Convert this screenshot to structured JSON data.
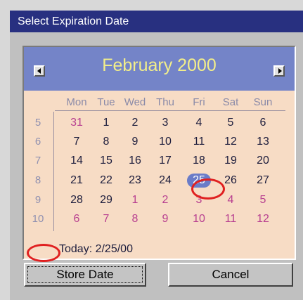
{
  "window": {
    "title": "Select Expiration Date"
  },
  "calendar": {
    "month_label": "February 2000",
    "prev_label": "previous month",
    "next_label": "next month",
    "weekdays": [
      "Mon",
      "Tue",
      "Wed",
      "Thu",
      "Fri",
      "Sat",
      "Sun"
    ],
    "weeks": [
      {
        "num": "5",
        "days": [
          {
            "d": "31",
            "other": true
          },
          {
            "d": "1"
          },
          {
            "d": "2"
          },
          {
            "d": "3"
          },
          {
            "d": "4"
          },
          {
            "d": "5"
          },
          {
            "d": "6"
          }
        ]
      },
      {
        "num": "6",
        "days": [
          {
            "d": "7"
          },
          {
            "d": "8"
          },
          {
            "d": "9"
          },
          {
            "d": "10"
          },
          {
            "d": "11"
          },
          {
            "d": "12"
          },
          {
            "d": "13"
          }
        ]
      },
      {
        "num": "7",
        "days": [
          {
            "d": "14"
          },
          {
            "d": "15"
          },
          {
            "d": "16"
          },
          {
            "d": "17"
          },
          {
            "d": "18"
          },
          {
            "d": "19"
          },
          {
            "d": "20"
          }
        ]
      },
      {
        "num": "8",
        "days": [
          {
            "d": "21"
          },
          {
            "d": "22"
          },
          {
            "d": "23"
          },
          {
            "d": "24"
          },
          {
            "d": "25",
            "selected": true
          },
          {
            "d": "26"
          },
          {
            "d": "27"
          }
        ]
      },
      {
        "num": "9",
        "days": [
          {
            "d": "28"
          },
          {
            "d": "29"
          },
          {
            "d": "1",
            "other": true
          },
          {
            "d": "2",
            "other": true
          },
          {
            "d": "3",
            "other": true
          },
          {
            "d": "4",
            "other": true
          },
          {
            "d": "5",
            "other": true
          }
        ]
      },
      {
        "num": "10",
        "days": [
          {
            "d": "6",
            "other": true
          },
          {
            "d": "7",
            "other": true
          },
          {
            "d": "8",
            "other": true
          },
          {
            "d": "9",
            "other": true
          },
          {
            "d": "10",
            "other": true
          },
          {
            "d": "11",
            "other": true
          },
          {
            "d": "12",
            "other": true
          }
        ]
      }
    ],
    "today_label": "Today: 2/25/00"
  },
  "buttons": {
    "store_label": "Store Date",
    "cancel_label": "Cancel"
  },
  "colors": {
    "titlebar": "#283080",
    "header": "#7484c8",
    "month_text": "#f2ee8a",
    "calendar_bg": "#f7dcc5",
    "other_month": "#b84090",
    "selected_bg": "#6a7cc8",
    "annotation": "#e02020"
  }
}
